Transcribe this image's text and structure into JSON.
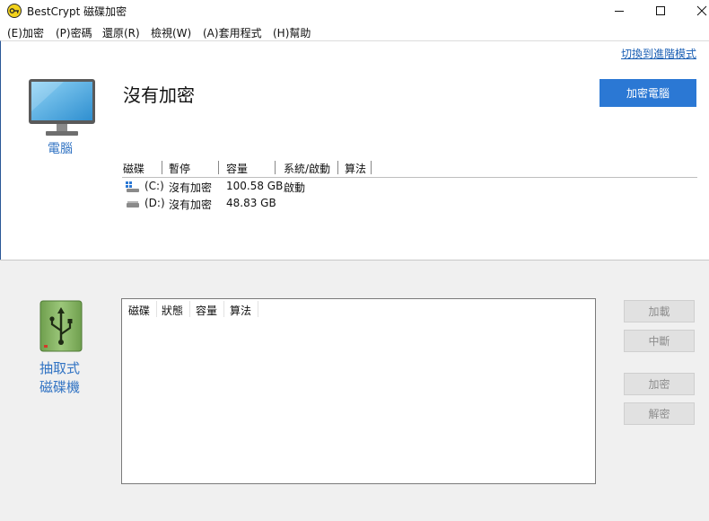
{
  "window": {
    "title": "BestCrypt 磁碟加密",
    "minimize_icon": "minimize-icon",
    "maximize_icon": "maximize-icon",
    "close_icon": "close-icon"
  },
  "menu": [
    {
      "label": "(E)加密"
    },
    {
      "label": "(P)密碼"
    },
    {
      "label": "還原(R)"
    },
    {
      "label": "檢視(W)"
    },
    {
      "label": "(A)套用程式"
    },
    {
      "label": "(H)幫助"
    }
  ],
  "computer": {
    "advanced_link": "切換到進階模式",
    "label": "電腦",
    "status_title": "沒有加密",
    "encrypt_button": "加密電腦",
    "columns": [
      "磁碟",
      "暫停",
      "容量",
      "系統/啟動",
      "算法"
    ],
    "disks": [
      {
        "icon": "windows-drive-icon",
        "drive": "(C:)",
        "status": "沒有加密",
        "capacity": "100.58 GB",
        "boot": "啟動",
        "algorithm": ""
      },
      {
        "icon": "drive-icon",
        "drive": "(D:)",
        "status": "沒有加密",
        "capacity": "48.83 GB",
        "boot": "",
        "algorithm": ""
      }
    ]
  },
  "removable": {
    "label_line1": "抽取式",
    "label_line2": "磁碟機",
    "columns": [
      "磁碟",
      "狀態",
      "容量",
      "算法"
    ],
    "buttons": {
      "mount": "加載",
      "unmount": "中斷",
      "encrypt": "加密",
      "decrypt": "解密"
    }
  },
  "colors": {
    "accent": "#2b78d4",
    "link": "#1a5fb4",
    "label_blue": "#3173c3",
    "usb_green": "#7fae5c"
  }
}
